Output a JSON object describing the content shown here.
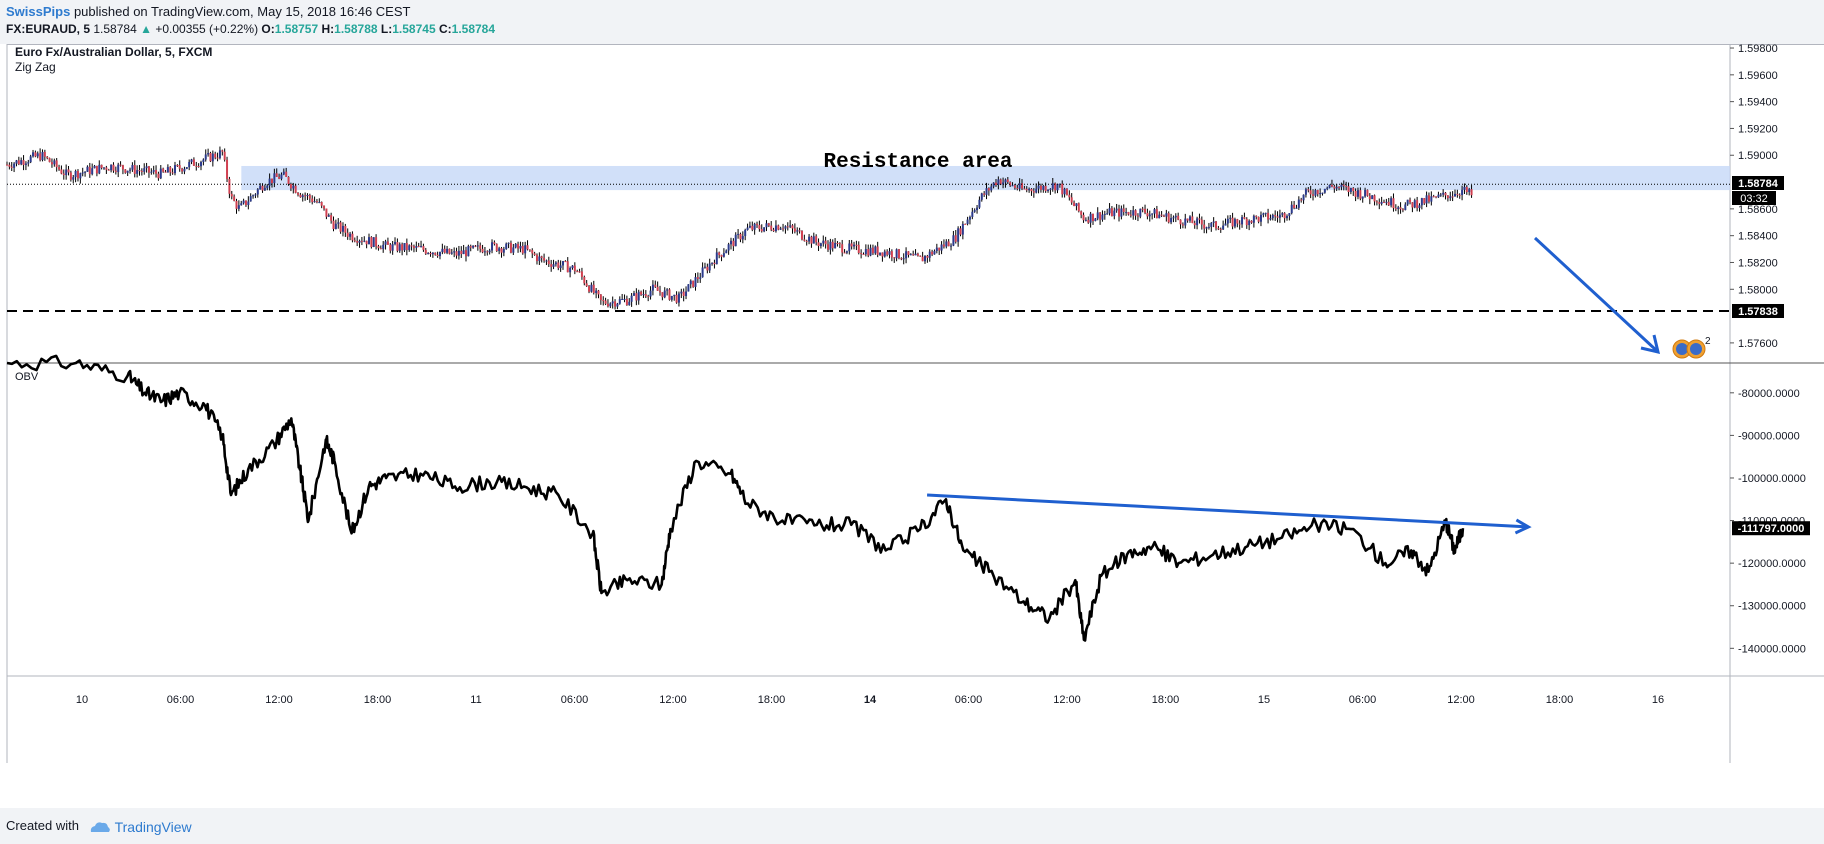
{
  "header": {
    "author": "SwissPips",
    "published": "published on TradingView.com, May 15, 2018 16:46 CEST",
    "symbol": "FX:EURAUD, 5",
    "last": "1.58784",
    "change_arrow": "▲",
    "change": "+0.00355 (+0.22%)",
    "o_label": "O:",
    "o_value": "1.58757",
    "h_label": "H:",
    "h_value": "1.58788",
    "l_label": "L:",
    "l_value": "1.58745",
    "c_label": "C:",
    "c_value": "1.58784"
  },
  "footer": {
    "created_with": "Created with",
    "brand": "TradingView"
  },
  "colors": {
    "up": "#26a69a",
    "accent": "#2e7bcf",
    "resistance_fill": "#c6d8f7",
    "annotation": "#1f5fcf",
    "candle_up": "#2b3a8c",
    "candle_down": "#d04050"
  },
  "chart_data": [
    {
      "type": "candlestick",
      "title": "Euro Fx/Australian Dollar, 5, FXCM",
      "indicator": "Zig Zag",
      "x_ticks": [
        "10",
        "06:00",
        "12:00",
        "18:00",
        "11",
        "06:00",
        "12:00",
        "18:00",
        "14",
        "06:00",
        "12:00",
        "18:00",
        "15",
        "06:00",
        "12:00",
        "18:00",
        "16"
      ],
      "y_ticks": [
        "1.59800",
        "1.59600",
        "1.59400",
        "1.59200",
        "1.59000",
        "1.58600",
        "1.58400",
        "1.58200",
        "1.58000",
        "1.57600"
      ],
      "ylim": [
        1.5745,
        1.5983
      ],
      "price_path": [
        [
          0,
          1.5893
        ],
        [
          0.02,
          1.59
        ],
        [
          0.035,
          1.5885
        ],
        [
          0.06,
          1.5892
        ],
        [
          0.09,
          1.5886
        ],
        [
          0.11,
          1.5895
        ],
        [
          0.125,
          1.5902
        ],
        [
          0.13,
          1.5868
        ],
        [
          0.135,
          1.586
        ],
        [
          0.15,
          1.588
        ],
        [
          0.16,
          1.5885
        ],
        [
          0.17,
          1.5872
        ],
        [
          0.18,
          1.5865
        ],
        [
          0.19,
          1.5848
        ],
        [
          0.2,
          1.584
        ],
        [
          0.22,
          1.5832
        ],
        [
          0.24,
          1.583
        ],
        [
          0.26,
          1.5826
        ],
        [
          0.28,
          1.5832
        ],
        [
          0.3,
          1.583
        ],
        [
          0.31,
          1.5822
        ],
        [
          0.33,
          1.5815
        ],
        [
          0.345,
          1.579
        ],
        [
          0.36,
          1.5792
        ],
        [
          0.375,
          1.58
        ],
        [
          0.39,
          1.5793
        ],
        [
          0.41,
          1.5822
        ],
        [
          0.43,
          1.5845
        ],
        [
          0.45,
          1.5848
        ],
        [
          0.47,
          1.5835
        ],
        [
          0.49,
          1.583
        ],
        [
          0.51,
          1.5828
        ],
        [
          0.53,
          1.5822
        ],
        [
          0.55,
          1.5838
        ],
        [
          0.565,
          1.5868
        ],
        [
          0.575,
          1.5882
        ],
        [
          0.59,
          1.5874
        ],
        [
          0.61,
          1.5878
        ],
        [
          0.625,
          1.5853
        ],
        [
          0.64,
          1.5857
        ],
        [
          0.66,
          1.5858
        ],
        [
          0.68,
          1.5852
        ],
        [
          0.7,
          1.5847
        ],
        [
          0.72,
          1.5852
        ],
        [
          0.74,
          1.5855
        ],
        [
          0.755,
          1.5872
        ],
        [
          0.77,
          1.5877
        ],
        [
          0.79,
          1.587
        ],
        [
          0.81,
          1.5862
        ],
        [
          0.83,
          1.5868
        ],
        [
          0.845,
          1.5874
        ],
        [
          0.85,
          1.587
        ]
      ],
      "resistance_area": {
        "label": "Resistance area",
        "range": [
          1.5874,
          1.5892
        ]
      },
      "current_price": {
        "value": 1.58784,
        "label": "1.58784",
        "countdown": "03:32"
      },
      "support_line": {
        "value": 1.57838,
        "label": "1.57838"
      },
      "badge": "2"
    },
    {
      "type": "line",
      "title": "OBV",
      "ylim": [
        -146500,
        -73000
      ],
      "y_ticks": [
        "-80000.0000",
        "-90000.0000",
        "-100000.0000",
        "-110000.0000",
        "-120000.0000",
        "-130000.0000",
        "-140000.0000"
      ],
      "last_label": "-111797.0000",
      "series": [
        {
          "values": [
            [
              0,
              -73000
            ],
            [
              0.04,
              -73000
            ],
            [
              0.07,
              -76000
            ],
            [
              0.08,
              -80000
            ],
            [
              0.09,
              -82000
            ],
            [
              0.1,
              -80000
            ],
            [
              0.115,
              -83000
            ],
            [
              0.125,
              -90000
            ],
            [
              0.13,
              -104000
            ],
            [
              0.14,
              -98000
            ],
            [
              0.155,
              -92000
            ],
            [
              0.165,
              -86000
            ],
            [
              0.17,
              -98000
            ],
            [
              0.175,
              -110000
            ],
            [
              0.185,
              -91000
            ],
            [
              0.19,
              -96000
            ],
            [
              0.2,
              -113000
            ],
            [
              0.21,
              -102000
            ],
            [
              0.22,
              -100000
            ],
            [
              0.24,
              -99000
            ],
            [
              0.26,
              -102000
            ],
            [
              0.28,
              -101000
            ],
            [
              0.3,
              -102000
            ],
            [
              0.32,
              -104000
            ],
            [
              0.34,
              -113000
            ],
            [
              0.345,
              -127000
            ],
            [
              0.36,
              -124000
            ],
            [
              0.38,
              -125000
            ],
            [
              0.385,
              -112000
            ],
            [
              0.4,
              -96000
            ],
            [
              0.42,
              -99000
            ],
            [
              0.43,
              -106000
            ],
            [
              0.45,
              -110000
            ],
            [
              0.47,
              -111000
            ],
            [
              0.49,
              -111000
            ],
            [
              0.51,
              -117000
            ],
            [
              0.53,
              -112000
            ],
            [
              0.545,
              -105000
            ],
            [
              0.555,
              -117000
            ],
            [
              0.57,
              -122000
            ],
            [
              0.59,
              -129000
            ],
            [
              0.605,
              -133000
            ],
            [
              0.62,
              -124000
            ],
            [
              0.625,
              -138000
            ],
            [
              0.635,
              -123000
            ],
            [
              0.65,
              -118000
            ],
            [
              0.665,
              -116000
            ],
            [
              0.68,
              -120000
            ],
            [
              0.7,
              -118000
            ],
            [
              0.72,
              -116000
            ],
            [
              0.74,
              -114000
            ],
            [
              0.76,
              -111000
            ],
            [
              0.78,
              -112000
            ],
            [
              0.8,
              -120000
            ],
            [
              0.815,
              -117000
            ],
            [
              0.825,
              -122000
            ],
            [
              0.835,
              -110000
            ],
            [
              0.84,
              -117000
            ],
            [
              0.845,
              -111797
            ]
          ]
        }
      ],
      "trendline": [
        [
          0.534,
          -104000
        ],
        [
          0.883,
          -111500
        ]
      ]
    }
  ]
}
